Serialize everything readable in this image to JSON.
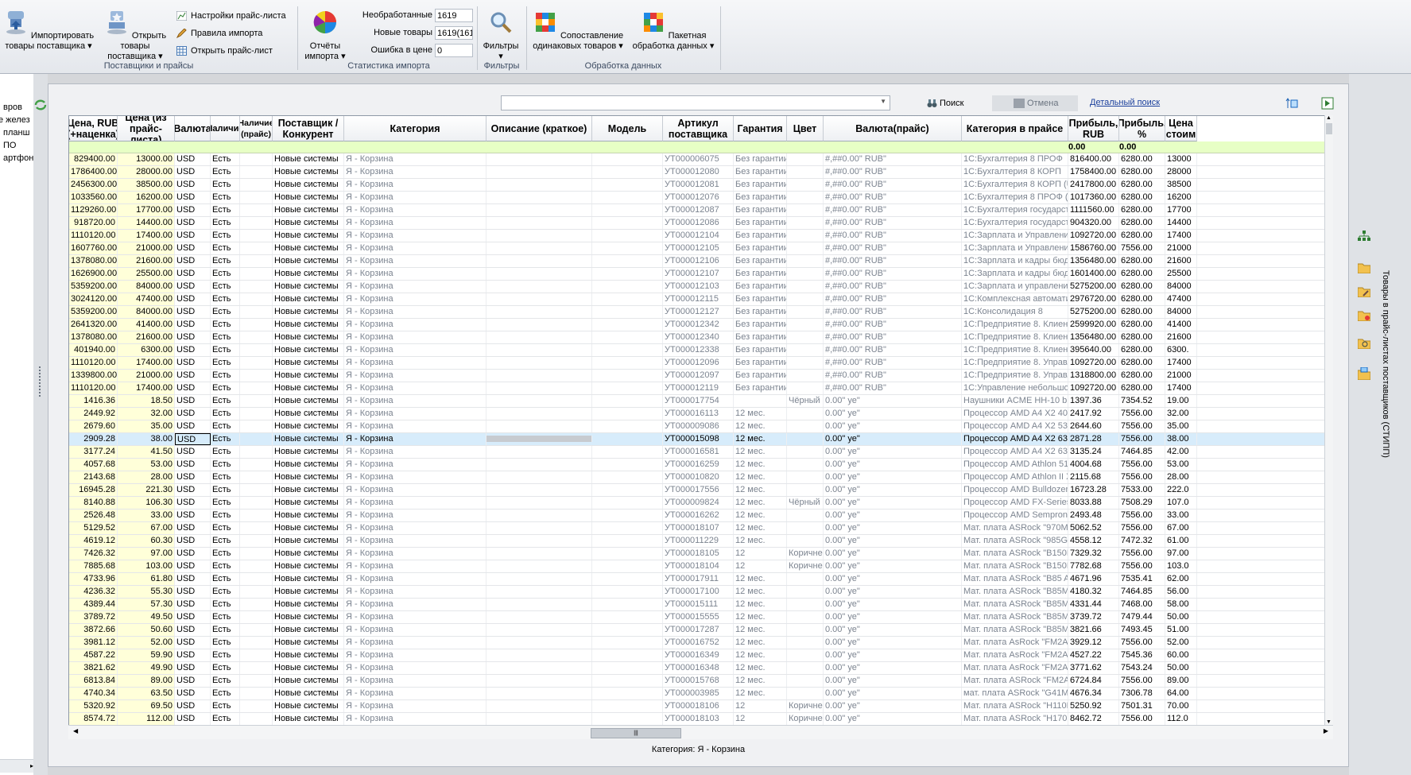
{
  "ribbon": {
    "import_btn": "Импортировать товары поставщика",
    "open_goods_btn": "Открыть товары поставщика",
    "price_settings": "Настройки прайс-листа",
    "import_rules": "Правила импорта",
    "open_price": "Открыть прайс-лист",
    "group1": "Поставщики и прайсы",
    "reports_btn": "Отчёты импорта",
    "stat_unprocessed_label": "Необработанные",
    "stat_unprocessed_value": "1619",
    "stat_new_label": "Новые товары",
    "stat_new_value": "1619(161",
    "stat_err_label": "Ошибка в цене",
    "stat_err_value": "0",
    "group2": "Статистика импорта",
    "filters_btn": "Фильтры",
    "group3": "Фильтры",
    "compare_btn": "Сопоставление одинаковых товаров",
    "batch_btn": "Пакетная обработка данных",
    "group4": "Обработка данных"
  },
  "left_panel": [
    "вров",
    "е желез",
    "планш",
    "ПО",
    "артфон"
  ],
  "search": {
    "search_btn": "Поиск",
    "cancel_btn": "Отмена",
    "detail_link": "Детальный поиск"
  },
  "columns": [
    "Цена, RUB (+наценка)",
    "Цена (из прайс-листа)",
    "Валюта",
    "Наличие",
    "Наличие (прайс)",
    "Поставщик / Конкурент",
    "Категория",
    "Описание (краткое)",
    "Модель",
    "Артикул поставщика",
    "Гарантия",
    "Цвет",
    "Валюта(прайс)",
    "Категория в прайсе",
    "Прибыль, RUB",
    "Прибыль, %",
    "Цена стоим"
  ],
  "footer_vals": {
    "profit_rub": "0.00",
    "profit_pct": "0.00"
  },
  "rows": [
    [
      "829400.00",
      "13000.00",
      "USD",
      "Есть",
      "",
      "Новые системы",
      "Я - Корзина",
      "",
      "",
      "УТ000006075",
      "Без гарантии",
      "",
      "#,##0.00\" RUB\"",
      "1С:Бухгалтерия 8 ПРОФ",
      "816400.00",
      "6280.00",
      "13000"
    ],
    [
      "1786400.00",
      "28000.00",
      "USD",
      "Есть",
      "",
      "Новые системы",
      "Я - Корзина",
      "",
      "",
      "УТ000012080",
      "Без гарантии",
      "",
      "#,##0.00\" RUB\"",
      "1С:Бухгалтерия 8 КОРП",
      "1758400.00",
      "6280.00",
      "28000"
    ],
    [
      "2456300.00",
      "38500.00",
      "USD",
      "Есть",
      "",
      "Новые системы",
      "Я - Корзина",
      "",
      "",
      "УТ000012081",
      "Без гарантии",
      "",
      "#,##0.00\" RUB\"",
      "1С:Бухгалтерия 8 КОРП (USB)",
      "2417800.00",
      "6280.00",
      "38500"
    ],
    [
      "1033560.00",
      "16200.00",
      "USD",
      "Есть",
      "",
      "Новые системы",
      "Я - Корзина",
      "",
      "",
      "УТ000012076",
      "Без гарантии",
      "",
      "#,##0.00\" RUB\"",
      "1С:Бухгалтерия 8 ПРОФ (USB",
      "1017360.00",
      "6280.00",
      "16200"
    ],
    [
      "1129260.00",
      "17700.00",
      "USD",
      "Есть",
      "",
      "Новые системы",
      "Я - Корзина",
      "",
      "",
      "УТ000012087",
      "Без гарантии",
      "",
      "#,##0.00\" RUB\"",
      "1С:Бухгалтерия государстве",
      "1111560.00",
      "6280.00",
      "17700"
    ],
    [
      "918720.00",
      "14400.00",
      "USD",
      "Есть",
      "",
      "Новые системы",
      "Я - Корзина",
      "",
      "",
      "УТ000012086",
      "Без гарантии",
      "",
      "#,##0.00\" RUB\"",
      "1С:Бухгалтерия государстве",
      "904320.00",
      "6280.00",
      "14400"
    ],
    [
      "1110120.00",
      "17400.00",
      "USD",
      "Есть",
      "",
      "Новые системы",
      "Я - Корзина",
      "",
      "",
      "УТ000012104",
      "Без гарантии",
      "",
      "#,##0.00\" RUB\"",
      "1С:Зарплата и Управление Пе",
      "1092720.00",
      "6280.00",
      "17400"
    ],
    [
      "1607760.00",
      "21000.00",
      "USD",
      "Есть",
      "",
      "Новые системы",
      "Я - Корзина",
      "",
      "",
      "УТ000012105",
      "Без гарантии",
      "",
      "#,##0.00\" RUB\"",
      "1С:Зарплата и Управление Пе",
      "1586760.00",
      "7556.00",
      "21000"
    ],
    [
      "1378080.00",
      "21600.00",
      "USD",
      "Есть",
      "",
      "Новые системы",
      "Я - Корзина",
      "",
      "",
      "УТ000012106",
      "Без гарантии",
      "",
      "#,##0.00\" RUB\"",
      "1С:Зарплата и кадры бюджет",
      "1356480.00",
      "6280.00",
      "21600"
    ],
    [
      "1626900.00",
      "25500.00",
      "USD",
      "Есть",
      "",
      "Новые системы",
      "Я - Корзина",
      "",
      "",
      "УТ000012107",
      "Без гарантии",
      "",
      "#,##0.00\" RUB\"",
      "1С:Зарплата и кадры бюджет",
      "1601400.00",
      "6280.00",
      "25500"
    ],
    [
      "5359200.00",
      "84000.00",
      "USD",
      "Есть",
      "",
      "Новые системы",
      "Я - Корзина",
      "",
      "",
      "УТ000012103",
      "Без гарантии",
      "",
      "#,##0.00\" RUB\"",
      "1С:Зарплата и управление пе",
      "5275200.00",
      "6280.00",
      "84000"
    ],
    [
      "3024120.00",
      "47400.00",
      "USD",
      "Есть",
      "",
      "Новые системы",
      "Я - Корзина",
      "",
      "",
      "УТ000012115",
      "Без гарантии",
      "",
      "#,##0.00\" RUB\"",
      "1С:Комплексная автоматиза",
      "2976720.00",
      "6280.00",
      "47400"
    ],
    [
      "5359200.00",
      "84000.00",
      "USD",
      "Есть",
      "",
      "Новые системы",
      "Я - Корзина",
      "",
      "",
      "УТ000012127",
      "Без гарантии",
      "",
      "#,##0.00\" RUB\"",
      "1С:Консолидация 8",
      "5275200.00",
      "6280.00",
      "84000"
    ],
    [
      "2641320.00",
      "41400.00",
      "USD",
      "Есть",
      "",
      "Новые системы",
      "Я - Корзина",
      "",
      "",
      "УТ000012342",
      "Без гарантии",
      "",
      "#,##0.00\" RUB\"",
      "1С:Предприятие 8. Клиентск",
      "2599920.00",
      "6280.00",
      "41400"
    ],
    [
      "1378080.00",
      "21600.00",
      "USD",
      "Есть",
      "",
      "Новые системы",
      "Я - Корзина",
      "",
      "",
      "УТ000012340",
      "Без гарантии",
      "",
      "#,##0.00\" RUB\"",
      "1С:Предприятие 8. Клиентск",
      "1356480.00",
      "6280.00",
      "21600"
    ],
    [
      "401940.00",
      "6300.00",
      "USD",
      "Есть",
      "",
      "Новые системы",
      "Я - Корзина",
      "",
      "",
      "УТ000012338",
      "Без гарантии",
      "",
      "#,##0.00\" RUB\"",
      "1С:Предприятие 8. Клиентск",
      "395640.00",
      "6280.00",
      "6300."
    ],
    [
      "1110120.00",
      "17400.00",
      "USD",
      "Есть",
      "",
      "Новые системы",
      "Я - Корзина",
      "",
      "",
      "УТ000012096",
      "Без гарантии",
      "",
      "#,##0.00\" RUB\"",
      "1С:Предприятие 8. Управлен",
      "1092720.00",
      "6280.00",
      "17400"
    ],
    [
      "1339800.00",
      "21000.00",
      "USD",
      "Есть",
      "",
      "Новые системы",
      "Я - Корзина",
      "",
      "",
      "УТ000012097",
      "Без гарантии",
      "",
      "#,##0.00\" RUB\"",
      "1С:Предприятие 8. Управлен",
      "1318800.00",
      "6280.00",
      "21000"
    ],
    [
      "1110120.00",
      "17400.00",
      "USD",
      "Есть",
      "",
      "Новые системы",
      "Я - Корзина",
      "",
      "",
      "УТ000012119",
      "Без гарантии",
      "",
      "#,##0.00\" RUB\"",
      "1С:Управление небольшой ф",
      "1092720.00",
      "6280.00",
      "17400"
    ],
    [
      "1416.36",
      "18.50",
      "USD",
      "Есть",
      "",
      "Новые системы",
      "Я - Корзина",
      "",
      "",
      "УТ000017754",
      "",
      "Чёрный",
      "0.00\" уе\"",
      "Наушники ACME HH-10 black",
      "1397.36",
      "7354.52",
      "19.00"
    ],
    [
      "2449.92",
      "32.00",
      "USD",
      "Есть",
      "",
      "Новые системы",
      "Я - Корзина",
      "",
      "",
      "УТ000016113",
      "12 мес.",
      "",
      "0.00\" уе\"",
      "Процессор AMD A4 X2 4020 3,",
      "2417.92",
      "7556.00",
      "32.00"
    ],
    [
      "2679.60",
      "35.00",
      "USD",
      "Есть",
      "",
      "Новые системы",
      "Я - Корзина",
      "",
      "",
      "УТ000009086",
      "12 мес.",
      "",
      "0.00\" уе\"",
      "Процессор AMD A4 X2 5300 3,",
      "2644.60",
      "7556.00",
      "35.00"
    ],
    [
      "2909.28",
      "38.00",
      "USD",
      "Есть",
      "",
      "Новые системы",
      "Я - Корзина",
      "",
      "",
      "УТ000015098",
      "12 мес.",
      "",
      "0.00\" уе\"",
      "Процессор AMD A4 X2 6300 3,",
      "2871.28",
      "7556.00",
      "38.00"
    ],
    [
      "3177.24",
      "41.50",
      "USD",
      "Есть",
      "",
      "Новые системы",
      "Я - Корзина",
      "",
      "",
      "УТ000016581",
      "12 мес.",
      "",
      "0.00\" уе\"",
      "Процессор AMD A4 X2 6320 4,",
      "3135.24",
      "7464.85",
      "42.00"
    ],
    [
      "4057.68",
      "53.00",
      "USD",
      "Есть",
      "",
      "Новые системы",
      "Я - Корзина",
      "",
      "",
      "УТ000016259",
      "12 мес.",
      "",
      "0.00\" уе\"",
      "Процессор AMD Athlon 5150 1,",
      "4004.68",
      "7556.00",
      "53.00"
    ],
    [
      "2143.68",
      "28.00",
      "USD",
      "Есть",
      "",
      "Новые системы",
      "Я - Корзина",
      "",
      "",
      "УТ000010820",
      "12 мес.",
      "",
      "0.00\" уе\"",
      "Процессор AMD Athlon II X2 3",
      "2115.68",
      "7556.00",
      "28.00"
    ],
    [
      "16945.28",
      "221.30",
      "USD",
      "Есть",
      "",
      "Новые системы",
      "Я - Корзина",
      "",
      "",
      "УТ000017556",
      "12 мес.",
      "",
      "0.00\" уе\"",
      "Процессор AMD Bulldozer FX-S",
      "16723.28",
      "7533.00",
      "222.0"
    ],
    [
      "8140.88",
      "106.30",
      "USD",
      "Есть",
      "",
      "Новые системы",
      "Я - Корзина",
      "",
      "",
      "УТ000009824",
      "12 мес.",
      "Чёрный",
      "0.00\" уе\"",
      "Процессор AMD  FX-Series X4 (",
      "8033.88",
      "7508.29",
      "107.0"
    ],
    [
      "2526.48",
      "33.00",
      "USD",
      "Есть",
      "",
      "Новые системы",
      "Я - Корзина",
      "",
      "",
      "УТ000016262",
      "12 мес.",
      "",
      "0.00\" уе\"",
      "Процессор AMD Sempron 3850",
      "2493.48",
      "7556.00",
      "33.00"
    ],
    [
      "5129.52",
      "67.00",
      "USD",
      "Есть",
      "",
      "Новые системы",
      "Я - Корзина",
      "",
      "",
      "УТ000018107",
      "12 мес.",
      "",
      "0.00\" уе\"",
      "Мат. плата ASRock \"970M PRO",
      "5062.52",
      "7556.00",
      "67.00"
    ],
    [
      "4619.12",
      "60.30",
      "USD",
      "Есть",
      "",
      "Новые системы",
      "Я - Корзина",
      "",
      "",
      "УТ000011229",
      "12 мес.",
      "",
      "0.00\" уе\"",
      "Мат. плата ASRock \"985GM-GS",
      "4558.12",
      "7472.32",
      "61.00"
    ],
    [
      "7426.32",
      "97.00",
      "USD",
      "Есть",
      "",
      "Новые системы",
      "Я - Корзина",
      "",
      "",
      "УТ000018105",
      "12",
      "Коричнев",
      "0.00\" уе\"",
      "Мат. плата ASRock \"B150M PR",
      "7329.32",
      "7556.00",
      "97.00"
    ],
    [
      "7885.68",
      "103.00",
      "USD",
      "Есть",
      "",
      "Новые системы",
      "Я - Корзина",
      "",
      "",
      "УТ000018104",
      "12",
      "Коричнев",
      "0.00\" уе\"",
      "Мат. плата ASRock \"B150M PR",
      "7782.68",
      "7556.00",
      "103.0"
    ],
    [
      "4733.96",
      "61.80",
      "USD",
      "Есть",
      "",
      "Новые системы",
      "Я - Корзина",
      "",
      "",
      "УТ000017911",
      "12 мес.",
      "",
      "0.00\" уе\"",
      "Мат. плата ASRock \"B85 ANN",
      "4671.96",
      "7535.41",
      "62.00"
    ],
    [
      "4236.32",
      "55.30",
      "USD",
      "Есть",
      "",
      "Новые системы",
      "Я - Корзина",
      "",
      "",
      "УТ000017100",
      "12 мес.",
      "",
      "0.00\" уе\"",
      "Мат. плата ASRock \"B85M-DG",
      "4180.32",
      "7464.85",
      "56.00"
    ],
    [
      "4389.44",
      "57.30",
      "USD",
      "Есть",
      "",
      "Новые системы",
      "Я - Корзина",
      "",
      "",
      "УТ000015111",
      "12 мес.",
      "",
      "0.00\" уе\"",
      "Мат. плата ASRock \"B85M-GL",
      "4331.44",
      "7468.00",
      "58.00"
    ],
    [
      "3789.72",
      "49.50",
      "USD",
      "Есть",
      "",
      "Новые системы",
      "Я - Корзина",
      "",
      "",
      "УТ000015555",
      "12 мес.",
      "",
      "0.00\" уе\"",
      "Мат. плата ASRock \"B85M-HD",
      "3739.72",
      "7479.44",
      "50.00"
    ],
    [
      "3872.66",
      "50.60",
      "USD",
      "Есть",
      "",
      "Новые системы",
      "Я - Корзина",
      "",
      "",
      "УТ000017287",
      "12 мес.",
      "",
      "0.00\" уе\"",
      "Мат. плата ASRock \"B85M-PR",
      "3821.66",
      "7493.45",
      "51.00"
    ],
    [
      "3981.12",
      "52.00",
      "USD",
      "Есть",
      "",
      "Новые системы",
      "Я - Корзина",
      "",
      "",
      "УТ000016752",
      "12 мес.",
      "",
      "0.00\" уе\"",
      "Мат. плата AsRock \"FM2A55 P",
      "3929.12",
      "7556.00",
      "52.00"
    ],
    [
      "4587.22",
      "59.90",
      "USD",
      "Есть",
      "",
      "Новые системы",
      "Я - Корзина",
      "",
      "",
      "УТ000016349",
      "12 мес.",
      "",
      "0.00\" уе\"",
      "Мат. плата AsRock \"FM2A78M",
      "4527.22",
      "7545.36",
      "60.00"
    ],
    [
      "3821.62",
      "49.90",
      "USD",
      "Есть",
      "",
      "Новые системы",
      "Я - Корзина",
      "",
      "",
      "УТ000016348",
      "12 мес.",
      "",
      "0.00\" уе\"",
      "Мат. плата AsRock \"FM2A88M",
      "3771.62",
      "7543.24",
      "50.00"
    ],
    [
      "6813.84",
      "89.00",
      "USD",
      "Есть",
      "",
      "Новые системы",
      "Я - Корзина",
      "",
      "",
      "УТ000015768",
      "12 мес.",
      "",
      "0.00\" уе\"",
      "Мат. плата ASRock \"FM2A88X-",
      "6724.84",
      "7556.00",
      "89.00"
    ],
    [
      "4740.34",
      "63.50",
      "USD",
      "Есть",
      "",
      "Новые системы",
      "Я - Корзина",
      "",
      "",
      "УТ000003985",
      "12 мес.",
      "",
      "0.00\" уе\"",
      "мат. плата ASRock \"G41M-VS3",
      "4676.34",
      "7306.78",
      "64.00"
    ],
    [
      "5320.92",
      "69.50",
      "USD",
      "Есть",
      "",
      "Новые системы",
      "Я - Корзина",
      "",
      "",
      "УТ000018106",
      "12",
      "Коричнев",
      "0.00\" уе\"",
      "Мат. плата ASRock \"H110M-DV",
      "5250.92",
      "7501.31",
      "70.00"
    ],
    [
      "8574.72",
      "112.00",
      "USD",
      "Есть",
      "",
      "Новые системы",
      "Я - Корзина",
      "",
      "",
      "УТ000018103",
      "12",
      "Коричнев",
      "0.00\" уе\"",
      "Мат. плата ASRock \"H170M PR",
      "8462.72",
      "7556.00",
      "112.0"
    ]
  ],
  "selected_row": 22,
  "status": "Категория: Я - Корзина",
  "right_panel_label": "Товары в прайс-листах поставщиков (СТИПП)"
}
